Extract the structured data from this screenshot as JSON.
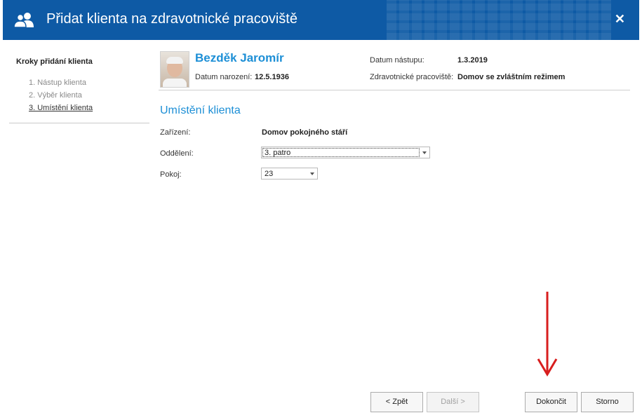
{
  "window": {
    "title": "Přidat klienta na zdravotnické pracoviště",
    "close_glyph": "✕"
  },
  "steps": {
    "title": "Kroky přidání klienta",
    "items": [
      {
        "label": "1. Nástup klienta",
        "active": false
      },
      {
        "label": "2. Výběr klienta",
        "active": false
      },
      {
        "label": "3. Umístění klienta",
        "active": true
      }
    ]
  },
  "client": {
    "name": "Bezděk Jaromír",
    "birth_label": "Datum narození:",
    "birth_value": "12.5.1936",
    "admission_label": "Datum nástupu:",
    "admission_value": "1.3.2019",
    "workplace_label": "Zdravotnické pracoviště:",
    "workplace_value": "Domov se zvláštním režimem"
  },
  "placement": {
    "section_title": "Umístění klienta",
    "facility_label": "Zařízení:",
    "facility_value": "Domov pokojného stáří",
    "department_label": "Oddělení:",
    "department_value": "3. patro",
    "room_label": "Pokoj:",
    "room_value": "23"
  },
  "buttons": {
    "back": "< Zpět",
    "next": "Další >",
    "finish": "Dokončit",
    "cancel": "Storno"
  },
  "colors": {
    "titlebar": "#0e5aa5",
    "accent": "#1d8fd6",
    "annotation_arrow": "#d81e1e"
  },
  "icons": {
    "title_icon": "users-icon",
    "close_icon": "close-icon"
  }
}
